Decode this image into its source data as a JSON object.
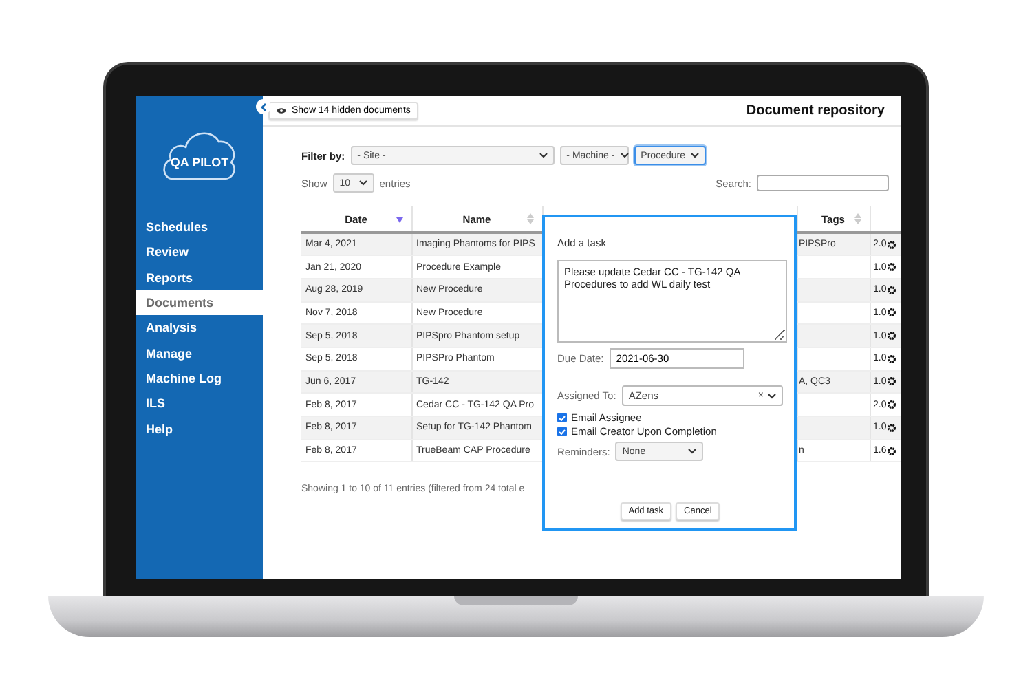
{
  "sidebar": {
    "logo": "QA PILOT",
    "items": [
      {
        "label": "Schedules",
        "selected": false
      },
      {
        "label": "Review",
        "selected": false
      },
      {
        "label": "Reports",
        "selected": false
      },
      {
        "label": "Documents",
        "selected": true
      },
      {
        "label": "Analysis",
        "selected": false
      },
      {
        "label": "Manage",
        "selected": false
      },
      {
        "label": "Machine Log",
        "selected": false
      },
      {
        "label": "ILS",
        "selected": false
      },
      {
        "label": "Help",
        "selected": false
      }
    ]
  },
  "toolbar": {
    "hidden_button": "Show 14 hidden documents",
    "title": "Document repository"
  },
  "filters": {
    "label": "Filter by:",
    "selects": [
      {
        "value": "- Site -",
        "focused": false
      },
      {
        "value": "- Machine -",
        "focused": false
      },
      {
        "value": "Procedure",
        "focused": true
      }
    ]
  },
  "length": {
    "before": "Show",
    "value": "10",
    "after": "entries"
  },
  "search": {
    "label": "Search:"
  },
  "table": {
    "columns": [
      {
        "label": "Date",
        "sorted": true
      },
      {
        "label": "Name",
        "sorted": false
      },
      {},
      {
        "label": "Tags",
        "sorted": false
      },
      {}
    ],
    "rows": [
      {
        "date": "Mar 4, 2021",
        "name": "Imaging Phantoms for PIPS",
        "tags": "PIPSPro",
        "column_5": "2.0"
      },
      {
        "date": "Jan 21, 2020",
        "name": "Procedure Example",
        "tags": "",
        "column_5": "1.0"
      },
      {
        "date": "Aug 28, 2019",
        "name": "New Procedure",
        "tags": "",
        "column_5": "1.0"
      },
      {
        "date": "Nov 7, 2018",
        "name": "New Procedure",
        "tags": "",
        "column_5": "1.0"
      },
      {
        "date": "Sep 5, 2018",
        "name": "PIPSpro Phantom setup",
        "tags": "",
        "column_5": "1.0"
      },
      {
        "date": "Sep 5, 2018",
        "name": "PIPSPro Phantom",
        "tags": "",
        "column_5": "1.0"
      },
      {
        "date": "Jun 6, 2017",
        "name": "TG-142",
        "tags": "A, QC3",
        "column_5": "1.0"
      },
      {
        "date": "Feb 8, 2017",
        "name": "Cedar CC - TG-142 QA Pro",
        "tags": "",
        "column_5": "2.0"
      },
      {
        "date": "Feb 8, 2017",
        "name": "Setup for TG-142 Phantom",
        "tags": "",
        "column_5": "1.0"
      },
      {
        "date": "Feb 8, 2017",
        "name": "TrueBeam CAP Procedure",
        "tags": "n",
        "column_5": "1.6"
      }
    ],
    "info": "Showing 1 to 10 of 11 entries (filtered from 24 total e"
  },
  "dialog": {
    "title": "Add a task",
    "description": "Please update Cedar CC - TG-142 QA Procedures to add WL daily test",
    "due_label": "Due Date:",
    "due_value": "2021-06-30",
    "assigned_label": "Assigned To:",
    "assigned_value": "AZens",
    "clear": "×",
    "checkboxes": [
      {
        "label": "Email Assignee",
        "checked": true
      },
      {
        "label": "Email Creator Upon Completion",
        "checked": true
      }
    ],
    "reminders_label": "Reminders:",
    "reminders_value": "None",
    "buttons": [
      "Add task",
      "Cancel"
    ]
  }
}
